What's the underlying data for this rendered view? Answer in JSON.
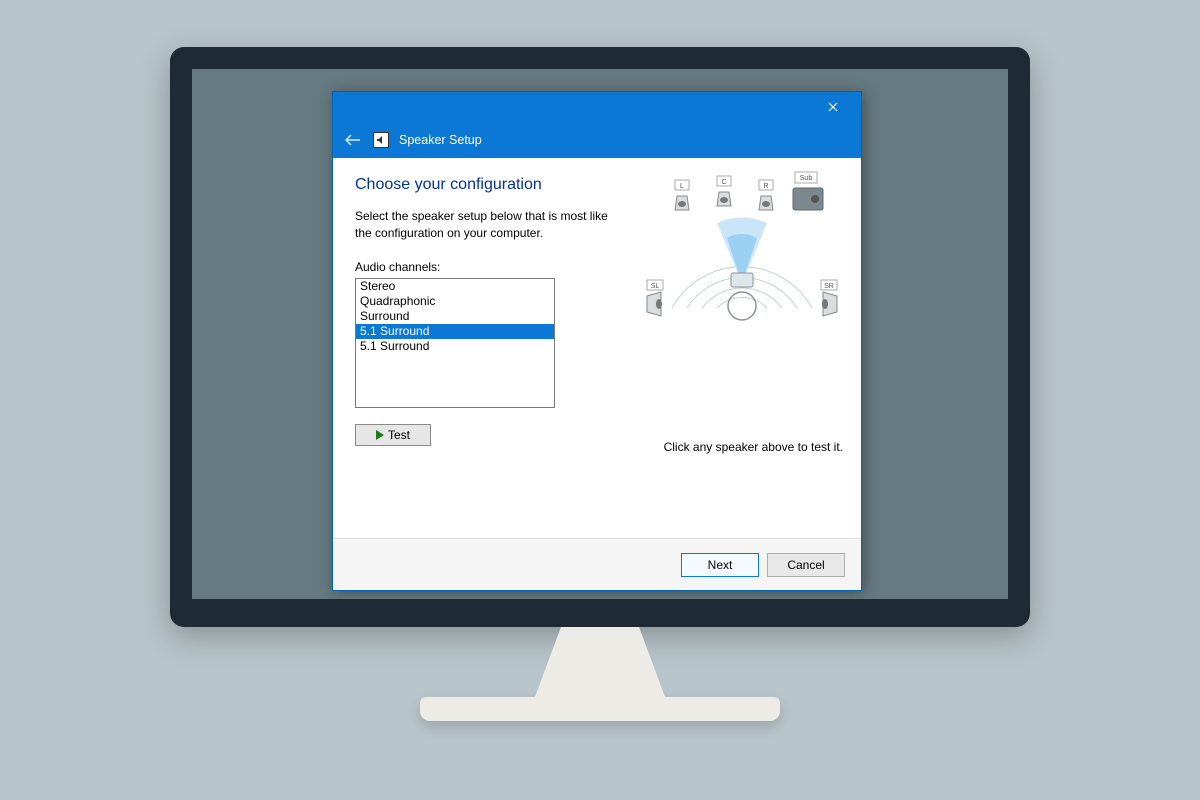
{
  "window": {
    "title": "Speaker Setup"
  },
  "page": {
    "heading": "Choose your configuration",
    "instruction": "Select the speaker setup below that is most like the configuration on your computer.",
    "channels_label": "Audio channels:",
    "test_label": "Test",
    "hint": "Click any speaker above to test it."
  },
  "channels": [
    {
      "name": "Stereo",
      "selected": false
    },
    {
      "name": "Quadraphonic",
      "selected": false
    },
    {
      "name": "Surround",
      "selected": false
    },
    {
      "name": "5.1 Surround",
      "selected": true
    },
    {
      "name": "5.1 Surround",
      "selected": false
    }
  ],
  "speakers": {
    "labels": {
      "L": "L",
      "C": "C",
      "R": "R",
      "Sub": "Sub",
      "SL": "SL",
      "SR": "SR"
    }
  },
  "footer": {
    "next": "Next",
    "cancel": "Cancel"
  }
}
